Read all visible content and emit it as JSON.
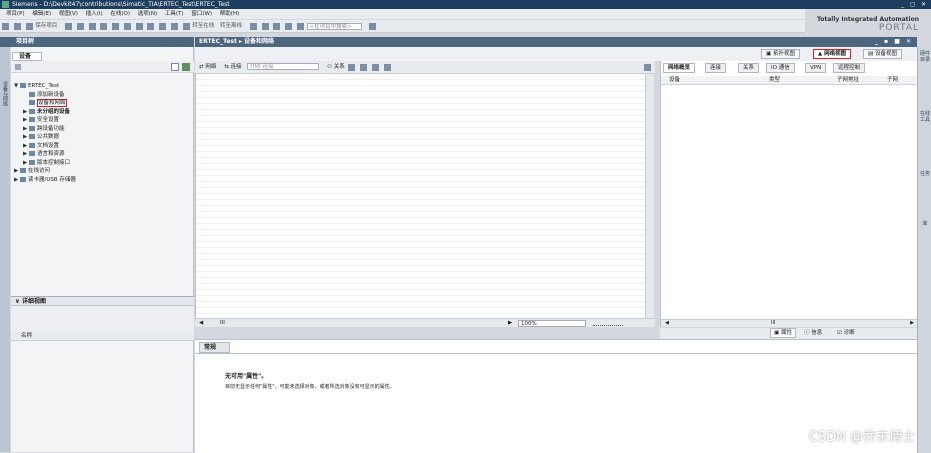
{
  "window": {
    "title": "Siemens - D:\\Devkit47\\contributions\\Simatic_TIA\\ERTEC_Test\\ERTEC_Test",
    "controls": "_ ◻ ✕"
  },
  "menu": [
    "项目(P)",
    "编辑(E)",
    "视图(V)",
    "插入(I)",
    "在线(O)",
    "选项(N)",
    "工具(T)",
    "窗口(W)",
    "帮助(H)"
  ],
  "toolbar": {
    "save": "保存项目",
    "go_online": "转至在线",
    "go_offline": "转至离线",
    "search_placeholder": "<在项目中搜索>"
  },
  "brand": {
    "line1": "Totally Integrated Automation",
    "line2": "PORTAL"
  },
  "project_tree": {
    "header": "项目树",
    "tab": "设备",
    "side_tab": "设备与网络",
    "items": [
      {
        "label": "ERTEC_Test",
        "level": 0,
        "expander": "▼"
      },
      {
        "label": "添加新设备",
        "level": 1,
        "expander": ""
      },
      {
        "label": "设备和网络",
        "level": 1,
        "expander": "",
        "highlight": true
      },
      {
        "label": "未分组的设备",
        "level": 1,
        "expander": "▶",
        "bold": true
      },
      {
        "label": "安全设置",
        "level": 1,
        "expander": "▶"
      },
      {
        "label": "跨设备功能",
        "level": 1,
        "expander": "▶"
      },
      {
        "label": "公共数据",
        "level": 1,
        "expander": "▶"
      },
      {
        "label": "文档设置",
        "level": 1,
        "expander": "▶"
      },
      {
        "label": "语言和资源",
        "level": 1,
        "expander": "▶"
      },
      {
        "label": "版本控制接口",
        "level": 1,
        "expander": "▶"
      },
      {
        "label": "在线访问",
        "level": 0,
        "expander": "▶"
      },
      {
        "label": "读卡器/USB 存储器",
        "level": 0,
        "expander": "▶"
      }
    ],
    "detail_view": "详细视图",
    "name_column": "名称"
  },
  "editor": {
    "breadcrumb": "ERTEC_Test ▸ 设备和网络",
    "window_controls": "_ ▪ ■ ✕",
    "views": {
      "topology": "拓扑视图",
      "network": "网络视图",
      "device": "设备视图"
    },
    "canvas_toolbar": {
      "network": "网络",
      "connections": "连接",
      "conn_type": "HMI 连接",
      "relations": "关系"
    },
    "zoom": "100%",
    "scroll_mark": "III"
  },
  "network_overview": {
    "tabs": [
      "网络概览",
      "连接",
      "关系",
      "IO 通信",
      "VPN",
      "远程控制"
    ],
    "columns": [
      "设备",
      "类型",
      "子网地址",
      "子网"
    ],
    "scroll_mark": "III"
  },
  "inspector": {
    "tabs": {
      "properties": "属性",
      "info": "信息",
      "diagnostics": "诊断"
    },
    "general_tab": "常规",
    "message_title": "无可用\"属性\"。",
    "message_body": "目前无显示任何\"属性\"。可能未选择对象，或者所选对象没有可显示的属性。"
  },
  "right_tasks": [
    "硬件目录",
    "在线工具",
    "任务",
    "库"
  ],
  "watermark": "CSDN @乔末博士"
}
